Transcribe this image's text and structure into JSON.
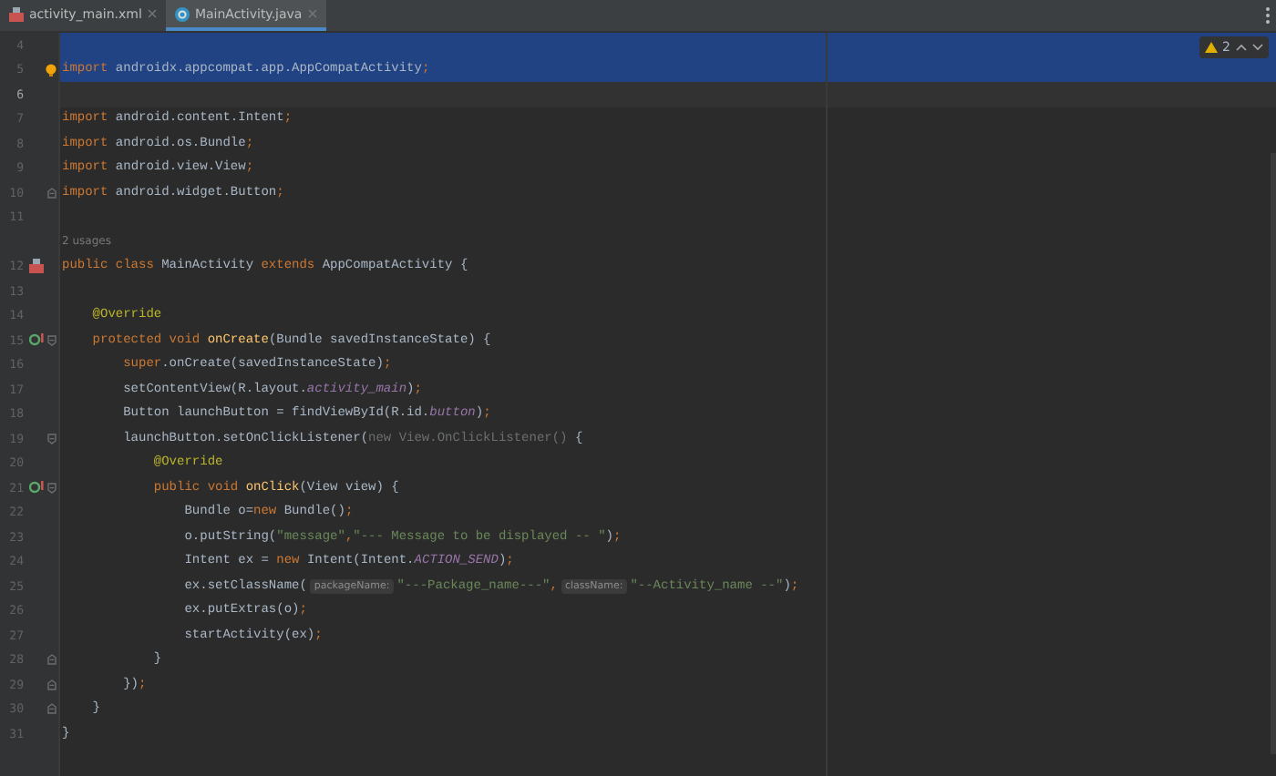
{
  "tabs": [
    {
      "label": "activity_main.xml",
      "kind": "xml",
      "selected": false
    },
    {
      "label": "MainActivity.java",
      "kind": "java",
      "selected": true
    }
  ],
  "inspections": {
    "warnings": "2"
  },
  "lines": [
    {
      "number": "4",
      "highlighted": true
    },
    {
      "number": "5",
      "highlighted": true,
      "bulb": true,
      "tokens": [
        {
          "t": "import",
          "kind": "kw"
        },
        {
          "t": " androidx.appcompat.app.AppCompatActivity",
          "kind": "plain"
        },
        {
          "t": ";",
          "kind": "kw"
        }
      ]
    },
    {
      "number": "6",
      "caret": true
    },
    {
      "number": "7",
      "tokens": [
        {
          "t": "import",
          "kind": "kw"
        },
        {
          "t": " android.content.Intent",
          "kind": "plain"
        },
        {
          "t": ";",
          "kind": "kw"
        }
      ]
    },
    {
      "number": "8",
      "tokens": [
        {
          "t": "import",
          "kind": "kw"
        },
        {
          "t": " android.os.Bundle",
          "kind": "plain"
        },
        {
          "t": ";",
          "kind": "kw"
        }
      ]
    },
    {
      "number": "9",
      "tokens": [
        {
          "t": "import",
          "kind": "kw"
        },
        {
          "t": " android.view.View",
          "kind": "plain"
        },
        {
          "t": ";",
          "kind": "kw"
        }
      ]
    },
    {
      "number": "10",
      "fold": {
        "kind": "end"
      },
      "tokens": [
        {
          "t": "import",
          "kind": "kw"
        },
        {
          "t": " android.widget.Button",
          "kind": "plain"
        },
        {
          "t": ";",
          "kind": "kw"
        }
      ]
    },
    {
      "number": "11"
    },
    {
      "kind": "usages",
      "tokens": [
        {
          "t": "2 usages",
          "kind": "hint"
        }
      ]
    },
    {
      "number": "12",
      "gutter": {
        "kind": "class"
      },
      "tokens": [
        {
          "t": "public class ",
          "kind": "kw"
        },
        {
          "t": "MainActivity ",
          "kind": "plain"
        },
        {
          "t": "extends ",
          "kind": "kw"
        },
        {
          "t": "AppCompatActivity {",
          "kind": "plain"
        }
      ]
    },
    {
      "number": "13"
    },
    {
      "number": "14",
      "tokens": [
        {
          "t": "    @Override",
          "kind": "ann"
        }
      ]
    },
    {
      "number": "15",
      "gutter": {
        "kind": "override"
      },
      "fold": {
        "kind": "start"
      },
      "tokens": [
        {
          "t": "    protected void ",
          "kind": "kw"
        },
        {
          "t": "onCreate",
          "kind": "fn"
        },
        {
          "t": "(Bundle savedInstanceState) {",
          "kind": "plain"
        }
      ]
    },
    {
      "number": "16",
      "tokens": [
        {
          "t": "        super",
          "kind": "kw"
        },
        {
          "t": ".onCreate(savedInstanceState)",
          "kind": "plain"
        },
        {
          "t": ";",
          "kind": "kw"
        }
      ]
    },
    {
      "number": "17",
      "tokens": [
        {
          "t": "        setContentView(R.layout.",
          "kind": "plain"
        },
        {
          "t": "activity_main",
          "kind": "field"
        },
        {
          "t": ")",
          "kind": "plain"
        },
        {
          "t": ";",
          "kind": "kw"
        }
      ]
    },
    {
      "number": "18",
      "tokens": [
        {
          "t": "        Button launchButton = findViewById(R.id.",
          "kind": "plain"
        },
        {
          "t": "button",
          "kind": "field"
        },
        {
          "t": ")",
          "kind": "plain"
        },
        {
          "t": ";",
          "kind": "kw"
        }
      ]
    },
    {
      "number": "19",
      "fold": {
        "kind": "start"
      },
      "tokens": [
        {
          "t": "        launchButton.setOnClickListener(",
          "kind": "plain"
        },
        {
          "t": "new View.OnClickListener()",
          "kind": "dim"
        },
        {
          "t": " {",
          "kind": "plain"
        }
      ]
    },
    {
      "number": "20",
      "tokens": [
        {
          "t": "            @Override",
          "kind": "ann"
        }
      ]
    },
    {
      "number": "21",
      "gutter": {
        "kind": "override"
      },
      "fold": {
        "kind": "start"
      },
      "tokens": [
        {
          "t": "            public void ",
          "kind": "kw"
        },
        {
          "t": "onClick",
          "kind": "fn"
        },
        {
          "t": "(View view) {",
          "kind": "plain"
        }
      ]
    },
    {
      "number": "22",
      "tokens": [
        {
          "t": "                Bundle o=",
          "kind": "plain"
        },
        {
          "t": "new ",
          "kind": "kw"
        },
        {
          "t": "Bundle()",
          "kind": "plain"
        },
        {
          "t": ";",
          "kind": "kw"
        }
      ]
    },
    {
      "number": "23",
      "tokens": [
        {
          "t": "                o.putString(",
          "kind": "plain"
        },
        {
          "t": "\"message\"",
          "kind": "str"
        },
        {
          "t": ",",
          "kind": "kw"
        },
        {
          "t": "\"--- Message to be displayed -- \"",
          "kind": "str"
        },
        {
          "t": ")",
          "kind": "plain"
        },
        {
          "t": ";",
          "kind": "kw"
        }
      ]
    },
    {
      "number": "24",
      "tokens": [
        {
          "t": "                Intent ex = ",
          "kind": "plain"
        },
        {
          "t": "new ",
          "kind": "kw"
        },
        {
          "t": "Intent(Intent.",
          "kind": "plain"
        },
        {
          "t": "ACTION_SEND",
          "kind": "field"
        },
        {
          "t": ")",
          "kind": "plain"
        },
        {
          "t": ";",
          "kind": "kw"
        }
      ]
    },
    {
      "number": "25",
      "tokens": [
        {
          "t": "                ex.setClassName(",
          "kind": "plain"
        },
        {
          "t": "packageName:",
          "kind": "inlay"
        },
        {
          "t": "\"---Package_name---\"",
          "kind": "str"
        },
        {
          "t": ",",
          "kind": "kw"
        },
        {
          "t": "className:",
          "kind": "inlay"
        },
        {
          "t": "\"--Activity_name --\"",
          "kind": "str"
        },
        {
          "t": ")",
          "kind": "plain"
        },
        {
          "t": ";",
          "kind": "kw"
        }
      ]
    },
    {
      "number": "26",
      "tokens": [
        {
          "t": "                ex.putExtras(o)",
          "kind": "plain"
        },
        {
          "t": ";",
          "kind": "kw"
        }
      ]
    },
    {
      "number": "27",
      "tokens": [
        {
          "t": "                startActivity(ex)",
          "kind": "plain"
        },
        {
          "t": ";",
          "kind": "kw"
        }
      ]
    },
    {
      "number": "28",
      "fold": {
        "kind": "end"
      },
      "tokens": [
        {
          "t": "            }",
          "kind": "plain"
        }
      ]
    },
    {
      "number": "29",
      "fold": {
        "kind": "end"
      },
      "tokens": [
        {
          "t": "        })",
          "kind": "plain"
        },
        {
          "t": ";",
          "kind": "kw"
        }
      ]
    },
    {
      "number": "30",
      "fold": {
        "kind": "end"
      },
      "tokens": [
        {
          "t": "    }",
          "kind": "plain"
        }
      ]
    },
    {
      "number": "31",
      "tokens": [
        {
          "t": "}",
          "kind": "plain"
        }
      ]
    }
  ]
}
